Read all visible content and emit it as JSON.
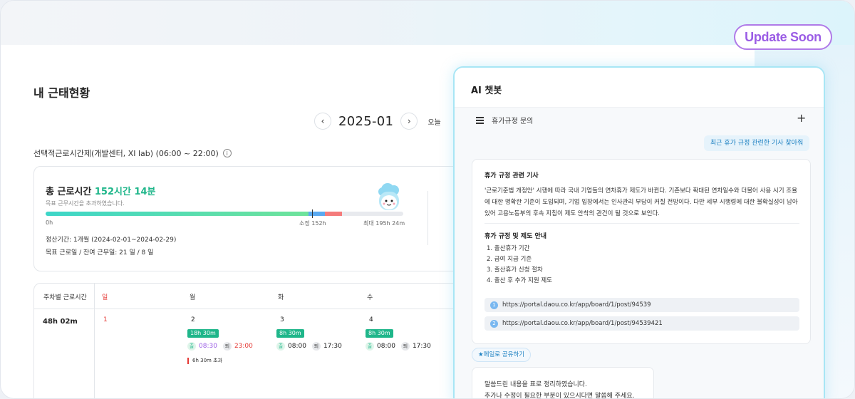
{
  "badge": {
    "label": "Update Soon"
  },
  "page": {
    "title": "내 근태현황"
  },
  "month_nav": {
    "prev_icon": "chevron-left-icon",
    "month": "2025-01",
    "next_icon": "chevron-right-icon",
    "today_label": "오늘"
  },
  "rule": {
    "text": "선택적근로시간제(개발센터, XI lab) (06:00 ~ 22:00)",
    "info_icon": "ⓘ"
  },
  "summary": {
    "total_prefix": "총 근로시간",
    "total_value": "152시간 14분",
    "note": "목표 근무시간을 초과하였습니다.",
    "bar_start": "0h",
    "bar_mid": "소정 152h",
    "bar_end": "최대 195h 24m",
    "period": "정산기간: 1개월 (2024-02-01~2024-02-29)",
    "target_days": "목표 근로일 / 잔여 근무일: 21 일 / 8 일",
    "progress": {
      "worked_fraction": 0.78,
      "regular_fraction": 0.78,
      "overtime_fraction": 0.0,
      "max_fraction": 1.0
    },
    "colors": {
      "worked": "#3dd6c8",
      "regular": "#5aa9f0",
      "overtime": "#f47b7b"
    }
  },
  "table": {
    "week_header": "주차별 근로시간",
    "days": [
      {
        "label": "일",
        "is_sunday": true
      },
      {
        "label": "월",
        "is_sunday": false
      },
      {
        "label": "화",
        "is_sunday": false
      },
      {
        "label": "수",
        "is_sunday": false
      }
    ],
    "week_total": "48h 02m",
    "cells": [
      {
        "date": "1"
      },
      {
        "date": "2",
        "hours": "18h 30m",
        "in_label": "출",
        "in_time": "08:30",
        "out_label": "퇴",
        "out_time": "23:00",
        "overtime": "6h 30m  초과"
      },
      {
        "date": "3",
        "hours": "8h 30m",
        "in_label": "출",
        "in_time": "08:00",
        "out_label": "퇴",
        "out_time": "17:30"
      },
      {
        "date": "4",
        "hours": "8h 30m",
        "in_label": "출",
        "in_time": "08:00",
        "out_label": "퇴",
        "out_time": "17:30"
      }
    ]
  },
  "chatbot": {
    "title": "AI 챗봇",
    "thread_title": "휴가규정 문의",
    "user_message": "최근 휴가 규정 관련한 기사 찾아줘",
    "answer": {
      "heading1": "휴가 규정 관련 기사",
      "paragraph": "'근로기준법 개정안' 시행에 따라 국내 기업들의 연차휴가 제도가 바뀐다. 기존보다 확대된 연차일수와 더불어 사용 시기 조율에 대한 명확한 기준이 도입되며, 기업 입장에서는 인사관리 부담이 커질 전망이다. 다만 세부 시행령에 대한 불확실성이 남아 있어 고용노동부의 후속 지침이 제도 안착의 관건이 될 것으로 보인다.",
      "heading2": "휴가 규정 및 제도 안내",
      "list": [
        "1.  출산휴가 기간",
        "2.  급여 지급 기준",
        "3.  출산휴가 신청 절차",
        "4.  출산 후 추가 지원 제도"
      ],
      "links": [
        {
          "num": "1",
          "url": "https://portal.daou.co.kr/app/board/1/post/94539"
        },
        {
          "num": "2",
          "url": "https://portal.daou.co.kr/app/board/1/post/94539421"
        }
      ]
    },
    "share_label": "★메일로 공유하기",
    "reply_line1": "말씀드린 내용을 표로 정리하였습니다.",
    "reply_line2": "추가나 수정이 필요한 부분이 있으시다면 말씀해 주세요."
  }
}
